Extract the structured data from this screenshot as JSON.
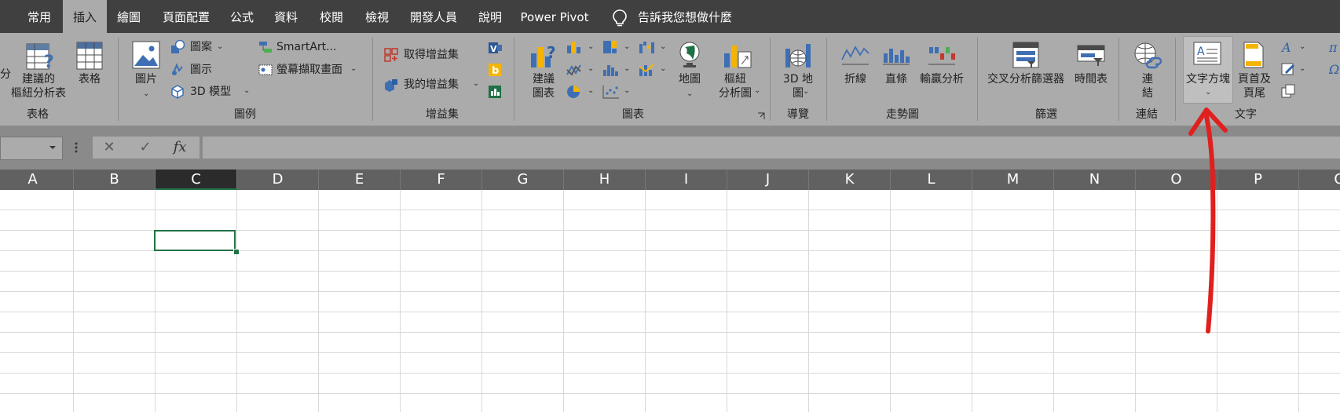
{
  "ribbon": {
    "tabs": [
      "常用",
      "插入",
      "繪圖",
      "頁面配置",
      "公式",
      "資料",
      "校閱",
      "檢視",
      "開發人員",
      "說明",
      "Power Pivot"
    ],
    "active_tab": "插入",
    "tell_me": "告訴我您想做什麼",
    "groups": {
      "tables": {
        "label": "表格",
        "partial_left": "分",
        "recommended_pivot": "建議的\n樞紐分析表",
        "table": "表格"
      },
      "illustrations": {
        "label": "圖例",
        "pictures": "圖片",
        "shapes": "圖案",
        "icons": "圖示",
        "models_3d": "3D 模型",
        "smartart": "SmartArt...",
        "screenshot": "螢幕擷取畫面"
      },
      "addins": {
        "label": "增益集",
        "get_addins": "取得增益集",
        "my_addins": "我的增益集"
      },
      "charts": {
        "label": "圖表",
        "recommended_charts": "建議\n圖表",
        "maps": "地圖",
        "pivot_chart": "樞紐\n分析圖"
      },
      "tours": {
        "label": "導覽",
        "map_3d": "3D 地\n圖"
      },
      "sparklines": {
        "label": "走勢圖",
        "line": "折線",
        "column": "直條",
        "win_loss": "輸贏分析"
      },
      "filters": {
        "label": "篩選",
        "slicer": "交叉分析篩選器",
        "timeline": "時間表"
      },
      "links": {
        "label": "連結",
        "link": "連\n結"
      },
      "text": {
        "label": "文字",
        "text_box": "文字方塊",
        "header_footer": "頁首及\n頁尾"
      }
    }
  },
  "formula_bar": {
    "name_box": "",
    "cancel_symbol": "✕",
    "enter_symbol": "✓",
    "fx_symbol": "fx",
    "content": ""
  },
  "sheet": {
    "columns": [
      "A",
      "B",
      "C",
      "D",
      "E",
      "F",
      "G",
      "H",
      "I",
      "J",
      "K",
      "L",
      "M",
      "N",
      "O",
      "P",
      "Q"
    ],
    "selected_column": "C"
  },
  "colors": {
    "tab_bar": "#404040",
    "ribbon": "#ababab",
    "selection": "#217346",
    "annotation_arrow": "#e0201e"
  }
}
